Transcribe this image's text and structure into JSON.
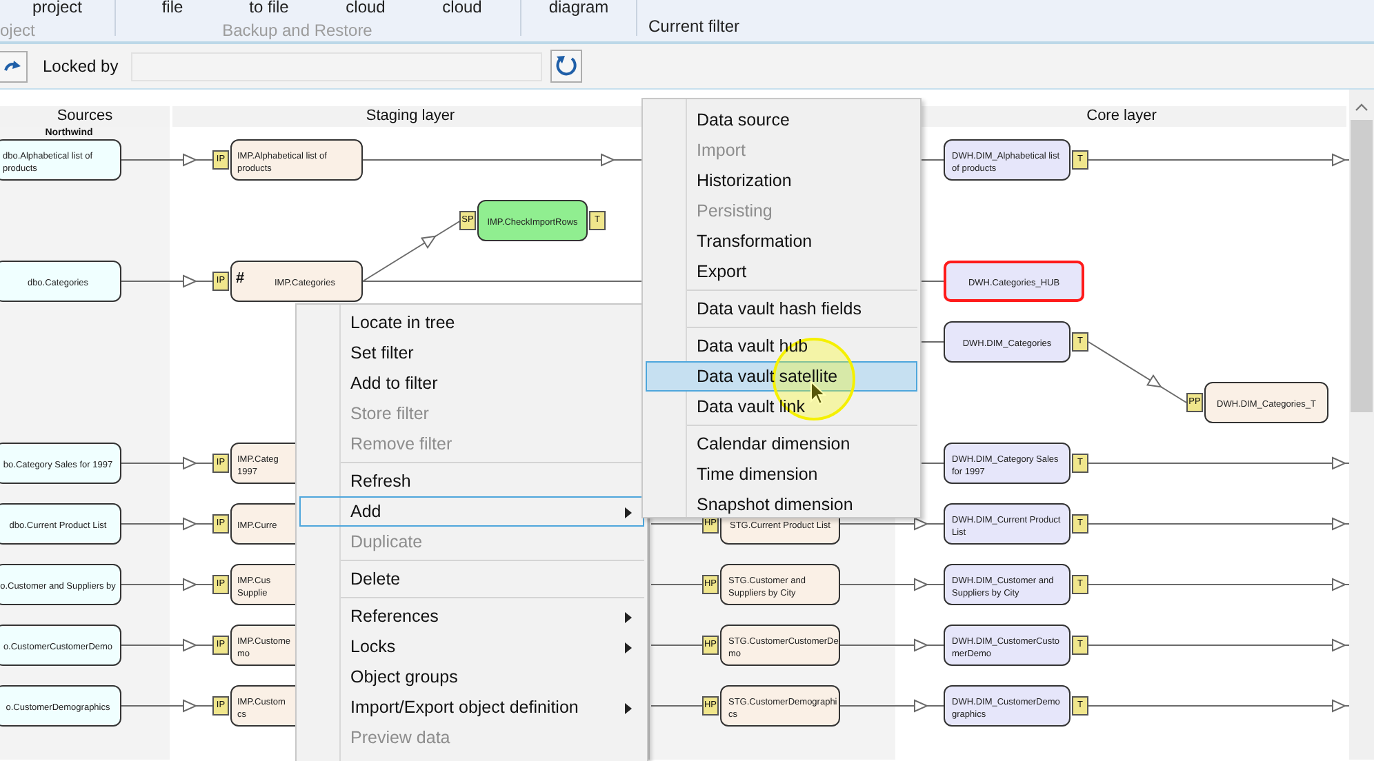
{
  "ribbon": {
    "groups": [
      {
        "label": "oject",
        "disabled": true,
        "buttons": [
          "project"
        ]
      },
      {
        "label": "Backup and Restore",
        "disabled": true,
        "buttons": [
          "file",
          "to file",
          "cloud",
          "cloud"
        ]
      },
      {
        "buttons": [
          "diagram"
        ]
      },
      {
        "label": "Current filter",
        "disabled": false
      }
    ]
  },
  "toolbar": {
    "locked_by_label": "Locked by"
  },
  "diagram": {
    "layers": [
      {
        "title": "Sources",
        "subtitle": "Northwind"
      },
      {
        "title": "Staging layer"
      },
      {
        "title": "Core layer"
      }
    ],
    "lanes": [
      {
        "source": {
          "lines": [
            "dbo.Alphabetical list of",
            "products"
          ]
        },
        "import": {
          "lines": [
            "IMP.Alphabetical list of",
            "products"
          ],
          "left_badge": "IP"
        },
        "core": {
          "lines": [
            "DWH.DIM_Alphabetical list",
            "of products"
          ],
          "right_badge": "T"
        }
      },
      {
        "check": {
          "lines": [
            "IMP.CheckImportRows"
          ],
          "left_badge": "SP",
          "right_badge": "T"
        }
      },
      {
        "source": {
          "lines": [
            "dbo.Categories"
          ]
        },
        "import": {
          "lines": [
            "IMP.Categories"
          ],
          "left_badge": "IP",
          "marker": "#"
        },
        "core": {
          "lines": [
            "DWH.Categories_HUB"
          ],
          "highlighted": true
        }
      },
      {
        "core": {
          "lines": [
            "DWH.DIM_Categories"
          ],
          "right_badge": "T"
        }
      },
      {
        "core_2": {
          "lines": [
            "DWH.DIM_Categories_T"
          ],
          "left_badge": "PP"
        }
      },
      {
        "source": {
          "lines": [
            "bo.Category Sales for 1997"
          ]
        },
        "import": {
          "lines": [
            "IMP.Categ",
            "1997"
          ],
          "left_badge": "IP"
        },
        "core": {
          "lines": [
            "DWH.DIM_Category Sales",
            "for 1997"
          ],
          "right_badge": "T"
        }
      },
      {
        "source": {
          "lines": [
            "dbo.Current Product List"
          ]
        },
        "import": {
          "lines": [
            "IMP.Curre"
          ],
          "left_badge": "IP"
        },
        "staging": {
          "lines": [
            "STG.Current Product List"
          ],
          "left_badge": "HP"
        },
        "core": {
          "lines": [
            "DWH.DIM_Current Product",
            "List"
          ],
          "right_badge": "T"
        }
      },
      {
        "source": {
          "lines": [
            "o.Customer and Suppliers by"
          ]
        },
        "import": {
          "lines": [
            "IMP.Cus",
            "Supplie"
          ],
          "left_badge": "IP"
        },
        "staging": {
          "lines": [
            "STG.Customer and",
            "Suppliers by City"
          ],
          "left_badge": "HP"
        },
        "core": {
          "lines": [
            "DWH.DIM_Customer and",
            "Suppliers by City"
          ],
          "right_badge": "T"
        }
      },
      {
        "source": {
          "lines": [
            "o.CustomerCustomerDemo"
          ]
        },
        "import": {
          "lines": [
            "IMP.Custome",
            "mo"
          ],
          "left_badge": "IP"
        },
        "staging": {
          "lines": [
            "STG.CustomerCustomerDe",
            "mo"
          ],
          "left_badge": "HP"
        },
        "core": {
          "lines": [
            "DWH.DIM_CustomerCusto",
            "merDemo"
          ],
          "right_badge": "T"
        }
      },
      {
        "source": {
          "lines": [
            "o.CustomerDemographics"
          ]
        },
        "import": {
          "lines": [
            "IMP.Custom",
            "cs"
          ],
          "left_badge": "IP"
        },
        "staging": {
          "lines": [
            "STG.CustomerDemographi",
            "cs"
          ],
          "left_badge": "HP"
        },
        "core": {
          "lines": [
            "DWH.DIM_CustomerDemo",
            "graphics"
          ],
          "right_badge": "T"
        }
      }
    ]
  },
  "context_menu": {
    "items": [
      {
        "kind": "item",
        "label": "Locate in tree",
        "disabled": false,
        "open": false,
        "submenu": false
      },
      {
        "kind": "item",
        "label": "Set filter",
        "disabled": false,
        "open": false,
        "submenu": false
      },
      {
        "kind": "item",
        "label": "Add to filter",
        "disabled": false,
        "open": false,
        "submenu": false
      },
      {
        "kind": "item",
        "label": "Store filter",
        "disabled": true,
        "open": false,
        "submenu": false
      },
      {
        "kind": "item",
        "label": "Remove filter",
        "disabled": true,
        "open": false,
        "submenu": false
      },
      {
        "kind": "separator"
      },
      {
        "kind": "item",
        "label": "Refresh",
        "disabled": false,
        "open": false,
        "submenu": false
      },
      {
        "kind": "item",
        "label": "Add",
        "disabled": false,
        "open": true,
        "submenu": true
      },
      {
        "kind": "item",
        "label": "Duplicate",
        "disabled": true,
        "open": false,
        "submenu": false
      },
      {
        "kind": "separator"
      },
      {
        "kind": "item",
        "label": "Delete",
        "disabled": false,
        "open": false,
        "submenu": false
      },
      {
        "kind": "separator"
      },
      {
        "kind": "item",
        "label": "References",
        "disabled": false,
        "open": false,
        "submenu": true
      },
      {
        "kind": "item",
        "label": "Locks",
        "disabled": false,
        "open": false,
        "submenu": true
      },
      {
        "kind": "item",
        "label": "Object groups",
        "disabled": false,
        "open": false,
        "submenu": false
      },
      {
        "kind": "item",
        "label": "Import/Export object definition",
        "disabled": false,
        "open": false,
        "submenu": true
      },
      {
        "kind": "item",
        "label": "Preview data",
        "disabled": true,
        "open": false,
        "submenu": false
      }
    ]
  },
  "submenu": {
    "items": [
      {
        "kind": "item",
        "label": "Data source",
        "disabled": false,
        "selected": false
      },
      {
        "kind": "item",
        "label": "Import",
        "disabled": true,
        "selected": false
      },
      {
        "kind": "item",
        "label": "Historization",
        "disabled": false,
        "selected": false
      },
      {
        "kind": "item",
        "label": "Persisting",
        "disabled": true,
        "selected": false
      },
      {
        "kind": "item",
        "label": "Transformation",
        "disabled": false,
        "selected": false
      },
      {
        "kind": "item",
        "label": "Export",
        "disabled": false,
        "selected": false
      },
      {
        "kind": "separator"
      },
      {
        "kind": "item",
        "label": "Data vault hash fields",
        "disabled": false,
        "selected": false
      },
      {
        "kind": "separator"
      },
      {
        "kind": "item",
        "label": "Data vault hub",
        "disabled": false,
        "selected": false
      },
      {
        "kind": "item",
        "label": "Data vault satellite",
        "disabled": false,
        "selected": true
      },
      {
        "kind": "item",
        "label": "Data vault link",
        "disabled": false,
        "selected": false
      },
      {
        "kind": "separator"
      },
      {
        "kind": "item",
        "label": "Calendar dimension",
        "disabled": false,
        "selected": false
      },
      {
        "kind": "item",
        "label": "Time dimension",
        "disabled": false,
        "selected": false
      },
      {
        "kind": "item",
        "label": "Snapshot dimension",
        "disabled": false,
        "selected": false
      }
    ]
  }
}
